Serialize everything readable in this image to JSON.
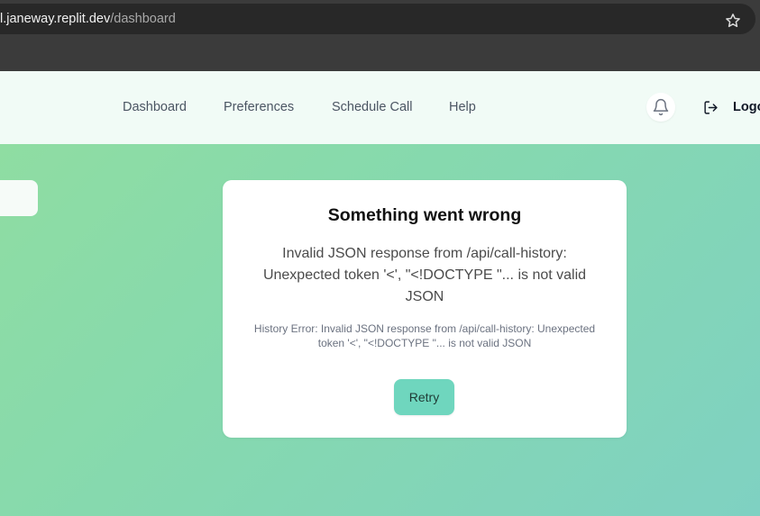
{
  "browser": {
    "url_host": "l.janeway.replit.dev",
    "url_path": "/dashboard",
    "bookmark_icon": "star-icon"
  },
  "nav": {
    "items": [
      {
        "label": "Dashboard"
      },
      {
        "label": "Preferences"
      },
      {
        "label": "Schedule Call"
      },
      {
        "label": "Help"
      }
    ],
    "notification_icon": "bell-icon",
    "logout_icon": "logout-icon",
    "logout_label": "Logo"
  },
  "error": {
    "title": "Something went wrong",
    "message": "Invalid JSON response from /api/call-history: Unexpected token '<', \"<!DOCTYPE \"... is not valid JSON",
    "detail": "History Error: Invalid JSON response from /api/call-history: Unexpected token '<', \"<!DOCTYPE \"... is not valid JSON",
    "retry_label": "Retry"
  },
  "colors": {
    "nav_bg": "#f1fbf6",
    "gradient_start": "#8fdda2",
    "gradient_end": "#7fd1c2",
    "retry_button": "#6fd6be"
  }
}
